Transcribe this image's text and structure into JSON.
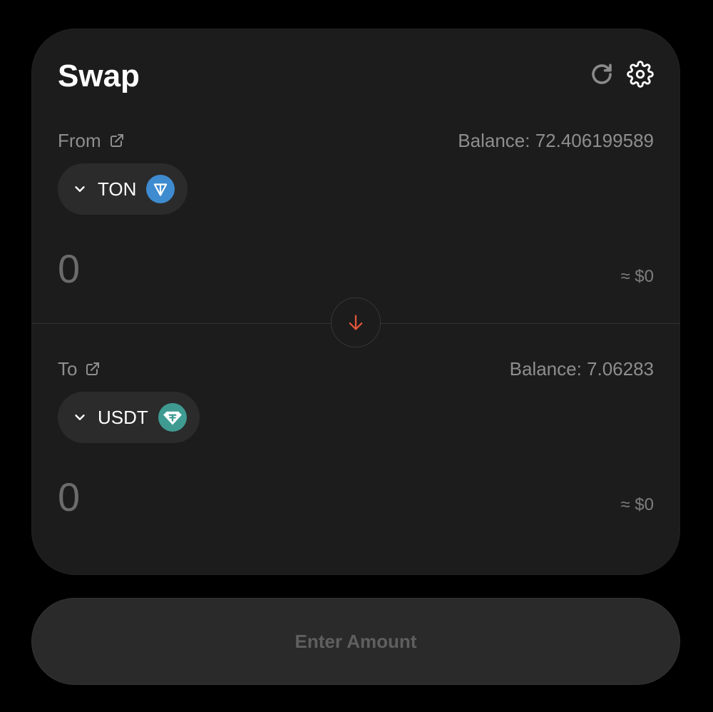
{
  "header": {
    "title": "Swap"
  },
  "from": {
    "label": "From",
    "balance": "Balance: 72.406199589",
    "token": "TON",
    "token_color": "#3f8bd0",
    "amount_placeholder": "0",
    "usd": "≈ $0"
  },
  "to": {
    "label": "To",
    "balance": "Balance: 7.06283",
    "token": "USDT",
    "token_color": "#3f9b92",
    "amount_placeholder": "0",
    "usd": "≈ $0"
  },
  "swap_direction_color": "#e0553a",
  "action": {
    "label": "Enter Amount"
  }
}
